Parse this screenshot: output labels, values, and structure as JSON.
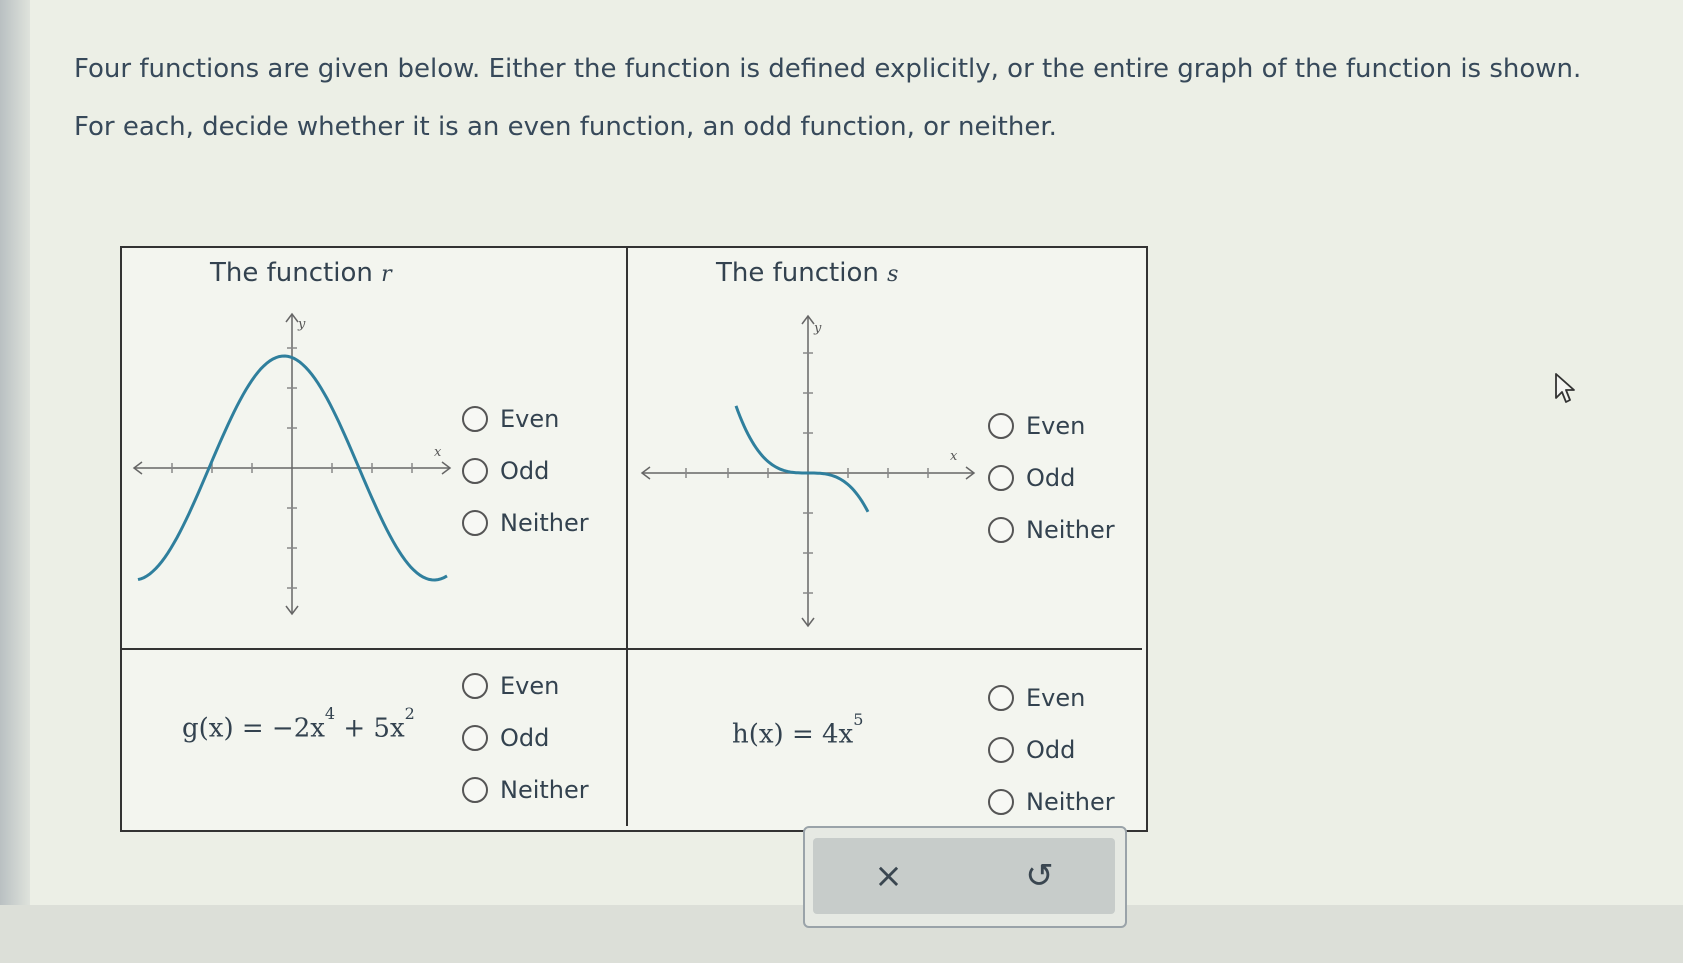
{
  "instructions": {
    "line1": "Four functions are given below. Either the function is defined explicitly, or the entire graph of the function is shown.",
    "line2": "For each, decide whether it is an even function, an odd function, or neither."
  },
  "cells": {
    "r": {
      "title_prefix": "The function",
      "var": "r",
      "x_label": "x",
      "y_label": "y",
      "options": [
        "Even",
        "Odd",
        "Neither"
      ]
    },
    "s": {
      "title_prefix": "The function",
      "var": "s",
      "x_label": "x",
      "y_label": "y",
      "options": [
        "Even",
        "Odd",
        "Neither"
      ]
    },
    "g": {
      "formula_left": "g(x) = −2x",
      "exp1": "4",
      "formula_mid": " + 5x",
      "exp2": "2",
      "options": [
        "Even",
        "Odd",
        "Neither"
      ]
    },
    "h": {
      "formula_left": "h(x) = 4x",
      "exp1": "5",
      "options": [
        "Even",
        "Odd",
        "Neither"
      ]
    }
  },
  "actions": {
    "clear_symbol": "×",
    "undo_symbol": "↺"
  },
  "colors": {
    "curve": "#2f7f9d",
    "axis": "#666666",
    "border": "#333333"
  },
  "icons": [
    "cursor-icon",
    "clear-icon",
    "undo-icon"
  ]
}
